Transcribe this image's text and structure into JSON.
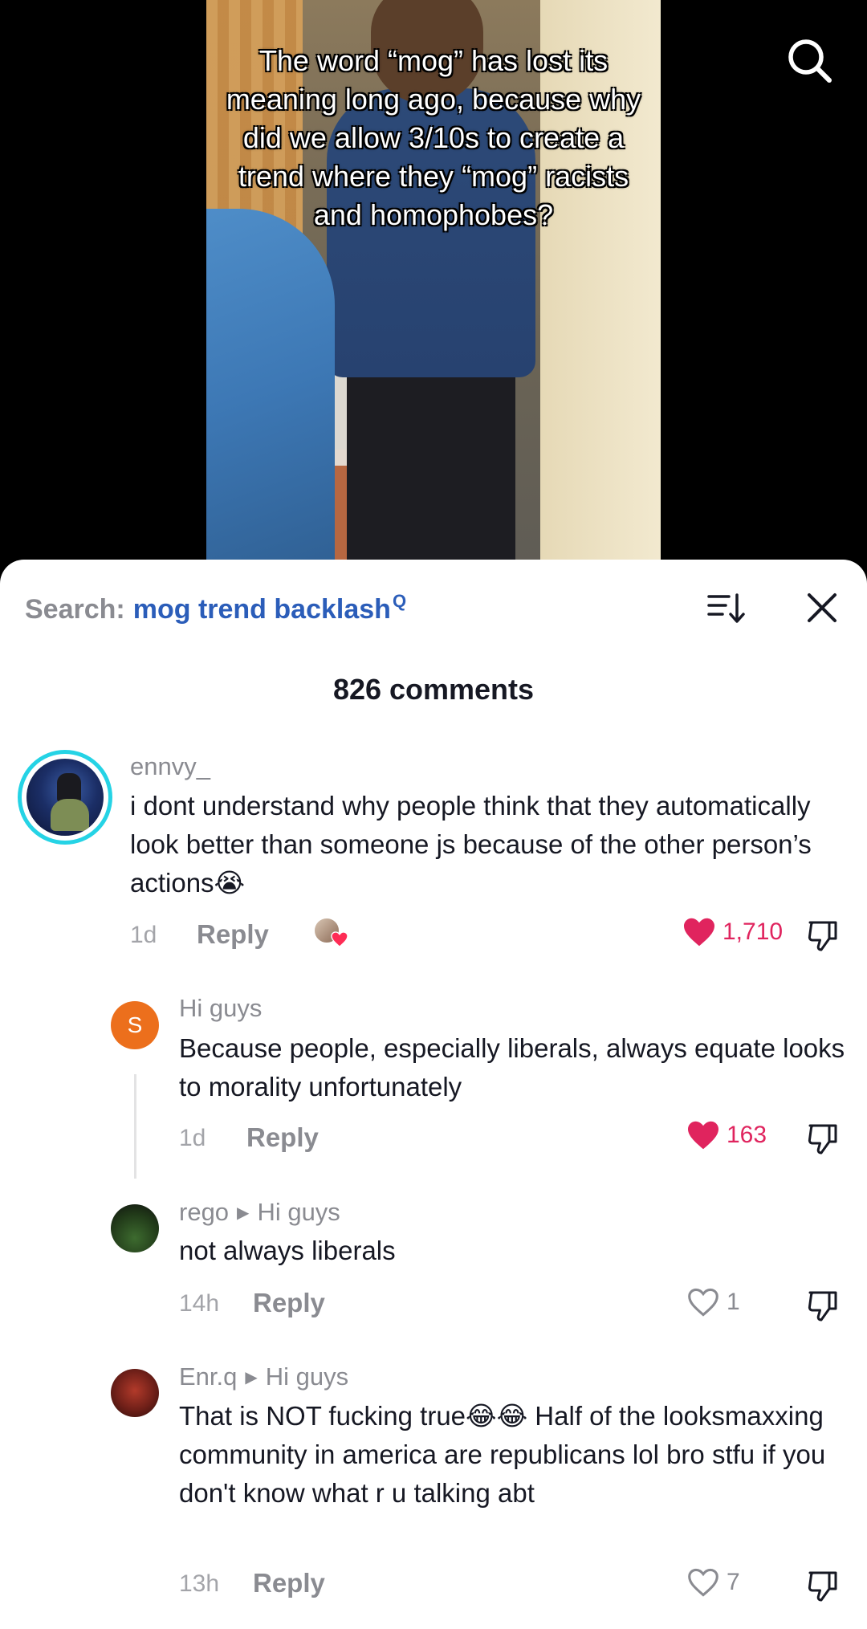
{
  "video": {
    "overlay_text": "The word “mog” has lost its meaning long ago, because why did we allow 3/10s to create a trend where they “mog” racists and homophobes?"
  },
  "search": {
    "prefix": "Search:",
    "term": "mog trend backlash",
    "mag_glyph": "Q"
  },
  "comments_header": {
    "count_label": "826 comments"
  },
  "reply_label": "Reply",
  "colors": {
    "accent_blue": "#2b5db9",
    "like_red": "#e0245e",
    "muted": "#8a8b91"
  },
  "comments": [
    {
      "username": "ennvy_",
      "text": "i dont understand why people think that they automatically look better than someone js because of the other person’s actions😭",
      "time": "1d",
      "likes": "1,710",
      "liked": true
    },
    {
      "username": "Hi guys",
      "avatar_letter": "S",
      "text": "Because people, especially liberals, always equate looks to morality unfortunately",
      "time": "1d",
      "likes": "163",
      "liked": true
    },
    {
      "username": "rego",
      "reply_to": "Hi guys",
      "text": "not always liberals",
      "time": "14h",
      "likes": "1",
      "liked": false
    },
    {
      "username": "Enr.q",
      "reply_to": "Hi guys",
      "text": "That is NOT fucking true😂😂 Half of the looksmaxxing community in america are republicans lol bro stfu if you don't know what r u talking abt",
      "time": "13h",
      "likes": "7",
      "liked": false
    }
  ]
}
